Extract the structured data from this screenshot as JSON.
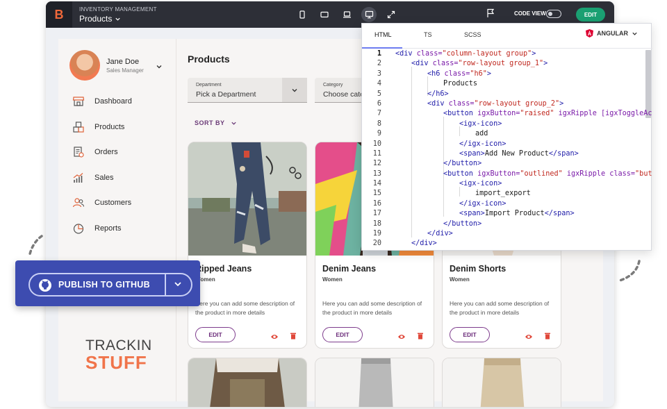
{
  "topbar": {
    "logo_text": "B",
    "app_subtitle": "INVENTORY MANAGEMENT",
    "app_title": "Products",
    "code_view_label": "CODE VIEW",
    "edit_label": "EDIT"
  },
  "user": {
    "name": "Jane Doe",
    "role": "Sales Manager"
  },
  "sidebar": {
    "items": [
      {
        "label": "Dashboard",
        "icon": "store-icon"
      },
      {
        "label": "Products",
        "icon": "boxes-icon"
      },
      {
        "label": "Orders",
        "icon": "orders-icon"
      },
      {
        "label": "Sales",
        "icon": "sales-chart-icon"
      },
      {
        "label": "Customers",
        "icon": "customers-icon"
      },
      {
        "label": "Reports",
        "icon": "pie-chart-icon"
      }
    ],
    "brand_line1": "TRACKIN",
    "brand_line2": "STUFF"
  },
  "main": {
    "title": "Products",
    "department": {
      "label": "Department",
      "value": "Pick a Department"
    },
    "category": {
      "label": "Category",
      "value": "Choose category"
    },
    "sort_label": "SORT BY"
  },
  "products": [
    {
      "title": "Ripped Jeans",
      "subtitle": "Women",
      "description": "Here you can add some description of the product in more details",
      "edit": "EDIT"
    },
    {
      "title": "Denim Jeans",
      "subtitle": "Women",
      "description": "Here you can add some description of the product in more details",
      "edit": "EDIT"
    },
    {
      "title": "Denim Shorts",
      "subtitle": "Women",
      "description": "Here you can add some description of the product in more details",
      "edit": "EDIT"
    }
  ],
  "code_panel": {
    "tabs": [
      "HTML",
      "TS",
      "SCSS"
    ],
    "active_tab": "HTML",
    "framework": "ANGULAR",
    "lines": [
      "1",
      "2",
      "3",
      "4",
      "5",
      "6",
      "7",
      "8",
      "9",
      "10",
      "11",
      "12",
      "13",
      "14",
      "15",
      "16",
      "17",
      "18",
      "19",
      "20"
    ],
    "code": {
      "l1_tag": "<div ",
      "l1_attr": "class=",
      "l1_str": "\"column-layout group\"",
      "l1_end": ">",
      "l2_tag": "<div ",
      "l2_attr": "class=",
      "l2_str": "\"row-layout group_1\"",
      "l2_end": ">",
      "l3_tag": "<h6 ",
      "l3_attr": "class=",
      "l3_str": "\"h6\"",
      "l3_end": ">",
      "l4_txt": "Products",
      "l5_tag": "</h6>",
      "l6_tag": "<div ",
      "l6_attr": "class=",
      "l6_str": "\"row-layout group_2\"",
      "l6_end": ">",
      "l7_tag": "<button ",
      "l7_attr": "igxButton=",
      "l7_str": "\"raised\"",
      "l7_attr2": " igxRipple [igxToggleActio",
      "l8_tag": "<igx-icon>",
      "l9_txt": "add",
      "l10_tag": "</igx-icon>",
      "l11_tag": "<span>",
      "l11_txt": "Add New Product",
      "l11_end": "</span>",
      "l12_tag": "</button>",
      "l13_tag": "<button ",
      "l13_attr": "igxButton=",
      "l13_str": "\"outlined\"",
      "l13_attr2": " igxRipple class=",
      "l13_str2": "\"button",
      "l14_tag": "<igx-icon>",
      "l15_txt": "import_export",
      "l16_tag": "</igx-icon>",
      "l17_tag": "<span>",
      "l17_txt": "Import Product",
      "l17_end": "</span>",
      "l18_tag": "</button>",
      "l19_tag": "</div>",
      "l20_tag": "</div>"
    }
  },
  "publish": {
    "label": "PUBLISH TO GITHUB"
  },
  "colors": {
    "accent": "#1aa072",
    "brand": "#f0744a",
    "publish": "#3d4cb0",
    "purple": "#6b2b7a"
  }
}
